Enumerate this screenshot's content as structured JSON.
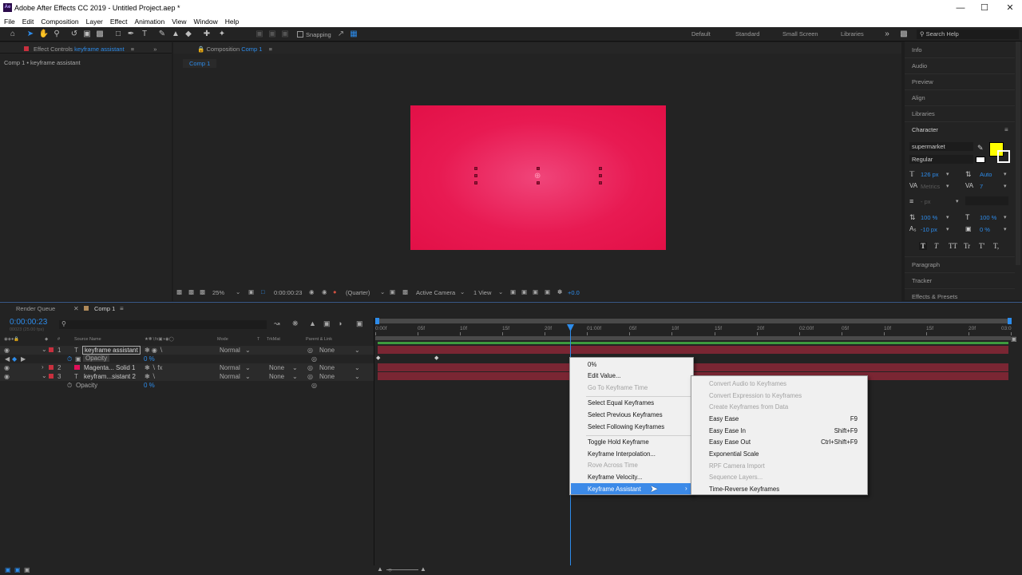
{
  "app": {
    "title": "Adobe After Effects CC 2019 - Untitled Project.aep *",
    "icon_text": "Ae"
  },
  "menubar": [
    "File",
    "Edit",
    "Composition",
    "Layer",
    "Effect",
    "Animation",
    "View",
    "Window",
    "Help"
  ],
  "toolbar": {
    "snapping": "Snapping",
    "search_placeholder": "Search Help",
    "workspaces": [
      "Default",
      "Standard",
      "Small Screen",
      "Libraries"
    ]
  },
  "effect_controls": {
    "tab": "Effect Controls",
    "tab_target": "keyframe assistant",
    "subtitle": "Comp 1 • keyframe assistant"
  },
  "composition": {
    "tab": "Composition",
    "tab_target": "Comp 1",
    "subtab": "Comp 1"
  },
  "viewer_footer": {
    "zoom": "25%",
    "timecode": "0:00:00:23",
    "resolution": "(Quarter)",
    "camera": "Active Camera",
    "views": "1 View",
    "exposure": "+0.0"
  },
  "right_panel": {
    "items": [
      "Info",
      "Audio",
      "Preview",
      "Align",
      "Libraries",
      "Character"
    ],
    "font": "supermarket",
    "style": "Regular",
    "font_size": "126 px",
    "leading": "Auto",
    "kerning": "Metrics",
    "tracking": "7",
    "stroke": "- px",
    "vscale": "100 %",
    "hscale": "100 %",
    "baseline": "-10 px",
    "tsume": "0 %",
    "fill_color": "#ffff00",
    "type_styles": [
      "T",
      "T",
      "TT",
      "Tr",
      "T'",
      "T,"
    ],
    "bottom_items": [
      "Paragraph",
      "Tracker",
      "Effects & Presets"
    ]
  },
  "timeline": {
    "tabs": [
      "Render Queue",
      "Comp 1"
    ],
    "timecode": "0:00:00:23",
    "sub_timecode": "00023 (25.00 fps)",
    "columns": {
      "num": "#",
      "source": "Source Name",
      "mode": "Mode",
      "t": "T",
      "trkmat": "TrkMat",
      "parent": "Parent & Link"
    },
    "layers": [
      {
        "num": "1",
        "type": "T",
        "name": "keyframe assistant",
        "mode": "Normal",
        "trkmat": "",
        "parent": "None"
      },
      {
        "num": "",
        "type": "",
        "name": "Opacity",
        "mode": "0 %",
        "trkmat": "",
        "parent": ""
      },
      {
        "num": "2",
        "type": "",
        "name": "Magenta... Solid 1",
        "mode": "Normal",
        "trkmat": "None",
        "parent": "None"
      },
      {
        "num": "3",
        "type": "T",
        "name": "keyfram...sistant 2",
        "mode": "Normal",
        "trkmat": "None",
        "parent": "None"
      },
      {
        "num": "",
        "type": "",
        "name": "Opacity",
        "mode": "0 %",
        "trkmat": "",
        "parent": ""
      }
    ],
    "ruler": [
      "0:00f",
      "05f",
      "10f",
      "15f",
      "20f",
      "01:00f",
      "05f",
      "10f",
      "15f",
      "20f",
      "02:00f",
      "05f",
      "10f",
      "15f",
      "20f",
      "03:0"
    ]
  },
  "context_menu": {
    "items": [
      {
        "label": "0%",
        "disabled": false
      },
      {
        "label": "Edit Value...",
        "disabled": false
      },
      {
        "label": "Go To Keyframe Time",
        "disabled": true
      },
      {
        "label": "Select Equal Keyframes",
        "disabled": false
      },
      {
        "label": "Select Previous Keyframes",
        "disabled": false
      },
      {
        "label": "Select Following Keyframes",
        "disabled": false
      },
      {
        "label": "Toggle Hold Keyframe",
        "disabled": false
      },
      {
        "label": "Keyframe Interpolation...",
        "disabled": false
      },
      {
        "label": "Rove Across Time",
        "disabled": true
      },
      {
        "label": "Keyframe Velocity...",
        "disabled": false
      },
      {
        "label": "Keyframe Assistant",
        "disabled": false
      }
    ]
  },
  "submenu": {
    "items": [
      {
        "label": "Convert Audio to Keyframes",
        "shortcut": "",
        "disabled": true
      },
      {
        "label": "Convert Expression to Keyframes",
        "shortcut": "",
        "disabled": true
      },
      {
        "label": "Create Keyframes from Data",
        "shortcut": "",
        "disabled": true
      },
      {
        "label": "Easy Ease",
        "shortcut": "F9",
        "disabled": false
      },
      {
        "label": "Easy Ease In",
        "shortcut": "Shift+F9",
        "disabled": false
      },
      {
        "label": "Easy Ease Out",
        "shortcut": "Ctrl+Shift+F9",
        "disabled": false
      },
      {
        "label": "Exponential Scale",
        "shortcut": "",
        "disabled": false
      },
      {
        "label": "RPF Camera Import",
        "shortcut": "",
        "disabled": true
      },
      {
        "label": "Sequence Layers...",
        "shortcut": "",
        "disabled": true
      },
      {
        "label": "Time-Reverse Keyframes",
        "shortcut": "",
        "disabled": false
      }
    ]
  }
}
